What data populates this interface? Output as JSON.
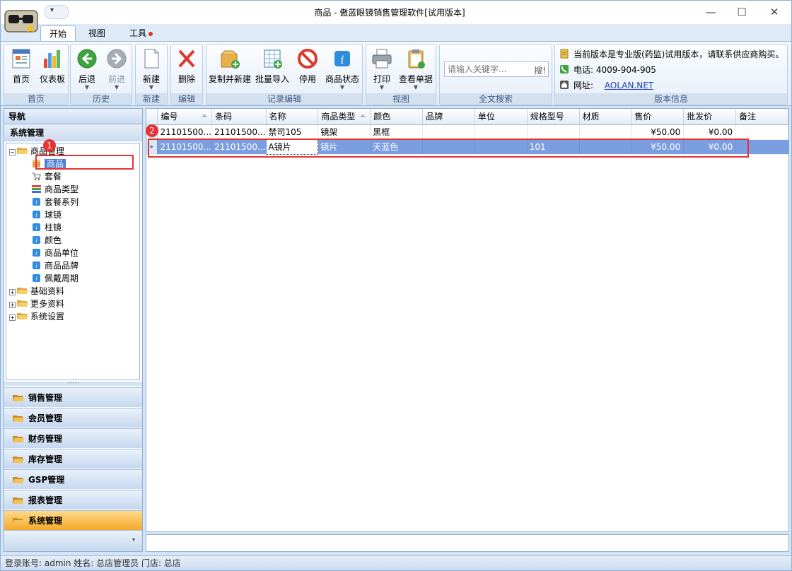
{
  "window": {
    "title": "商品 - 傲蓝眼镜销售管理软件[试用版本]",
    "minimize": "—",
    "maximize": "☐",
    "close": "✕",
    "qat_arrow": "▾"
  },
  "tabs": [
    "开始",
    "视图",
    "工具"
  ],
  "ribbon": {
    "groups": [
      "首页",
      "历史",
      "新建",
      "编辑",
      "记录编辑",
      "视图",
      "全文搜索",
      "版本信息"
    ],
    "buttons": {
      "home": "首页",
      "dashboard": "仪表板",
      "back": "后退",
      "forward": "前进",
      "new": "新建",
      "delete": "删除",
      "copy_new": "复制并新建",
      "batch_import": "批量导入",
      "disable": "停用",
      "status": "商品状态",
      "print": "打印",
      "view_doc": "查看单据"
    },
    "search": {
      "placeholder": "请输入关键字...",
      "button": "搜!"
    },
    "version": {
      "notice": "当前版本是专业版(药监)试用版本，请联系供应商购买。",
      "phone": "电话:  4009-904-905",
      "site_label": "网址:",
      "site_link": "AOLAN.NET"
    }
  },
  "nav": {
    "title": "导航",
    "section": "系统管理",
    "tree": {
      "root": "商品管理",
      "children": [
        "商品",
        "套餐",
        "商品类型",
        "套餐系列",
        "球镜",
        "柱镜",
        "颜色",
        "商品单位",
        "商品品牌",
        "佩戴周期"
      ],
      "others": [
        "基础资料",
        "更多资料",
        "系统设置"
      ]
    },
    "splitter": "•••••",
    "accordion": [
      "销售管理",
      "会员管理",
      "财务管理",
      "库存管理",
      "GSP管理",
      "报表管理",
      "系统管理"
    ],
    "footer_arrow": "▾"
  },
  "grid": {
    "columns": [
      "编号",
      "条码",
      "名称",
      "商品类型",
      "颜色",
      "品牌",
      "单位",
      "规格型号",
      "材质",
      "售价",
      "批发价",
      "备注"
    ],
    "rows": [
      [
        "21101500...",
        "21101500...",
        "禁司105",
        "镜架",
        "黑框",
        "",
        "",
        "",
        "",
        "¥50.00",
        "¥0.00",
        ""
      ],
      [
        "21101500...",
        "21101500...",
        "A镜片",
        "镜片",
        "天蓝色",
        "",
        "",
        "101",
        "",
        "¥50.00",
        "¥0.00",
        ""
      ]
    ],
    "row_indicator": "▸"
  },
  "annotations": [
    "1",
    "2"
  ],
  "status": "登录账号: admin   姓名: 总店管理员   门店: 总店"
}
